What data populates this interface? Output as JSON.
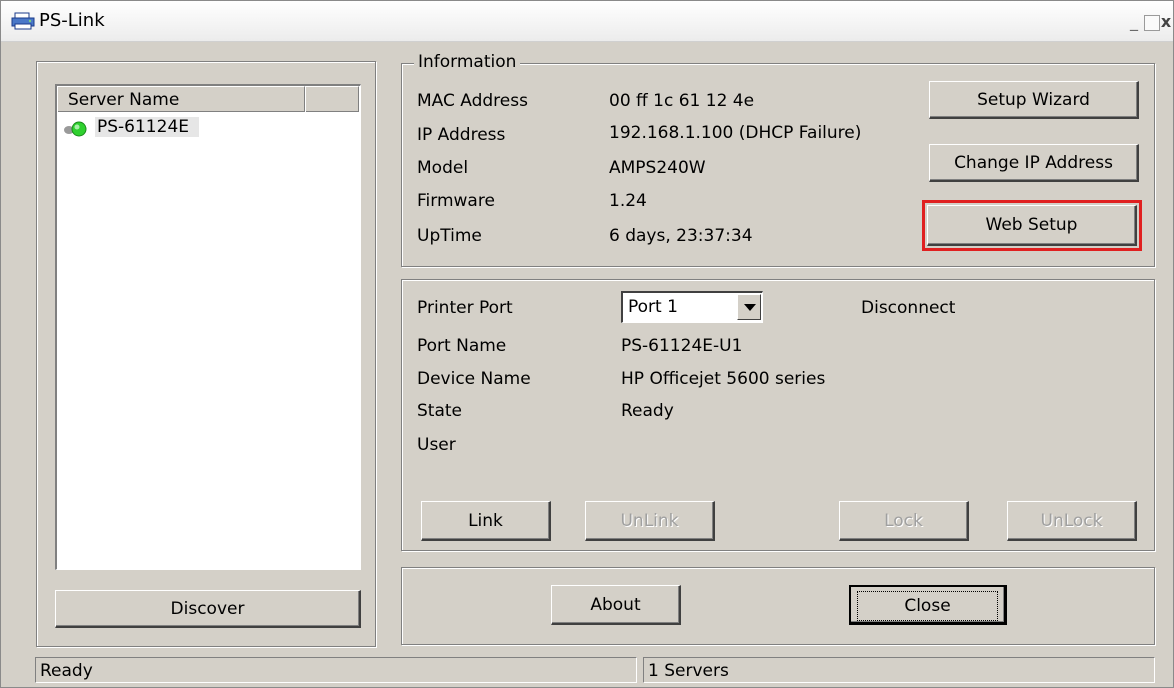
{
  "window": {
    "title": "PS-Link",
    "icon": "printer-network-icon",
    "controls": {
      "minimize": "_",
      "close": "x"
    }
  },
  "server_list": {
    "columns": [
      "Server Name",
      ""
    ],
    "items": [
      {
        "name": "PS-61124E",
        "status_icon": "green-status-led-icon"
      }
    ],
    "discover_label": "Discover"
  },
  "information": {
    "legend": "Information",
    "fields": [
      {
        "label": "MAC Address",
        "value": "00 ff 1c 61 12 4e"
      },
      {
        "label": "IP Address",
        "value": "192.168.1.100 (DHCP Failure)"
      },
      {
        "label": "Model",
        "value": "AMPS240W"
      },
      {
        "label": "Firmware",
        "value": "1.24"
      },
      {
        "label": "UpTime",
        "value": "6 days, 23:37:34"
      }
    ],
    "buttons": {
      "setup_wizard": "Setup Wizard",
      "change_ip": "Change IP Address",
      "web_setup": "Web Setup"
    },
    "highlight_color": "#e02020"
  },
  "port": {
    "printer_port_label": "Printer Port",
    "printer_port_value": "Port 1",
    "connection_status": "Disconnect",
    "fields": [
      {
        "label": "Port Name",
        "value": "PS-61124E-U1"
      },
      {
        "label": "Device Name",
        "value": "HP Officejet 5600 series"
      },
      {
        "label": "State",
        "value": "Ready"
      },
      {
        "label": "User",
        "value": ""
      }
    ],
    "buttons": {
      "link": "Link",
      "unlink": "UnLink",
      "lock": "Lock",
      "unlock": "UnLock"
    }
  },
  "footer_buttons": {
    "about": "About",
    "close": "Close"
  },
  "statusbar": {
    "left": "Ready",
    "right": "1 Servers"
  }
}
